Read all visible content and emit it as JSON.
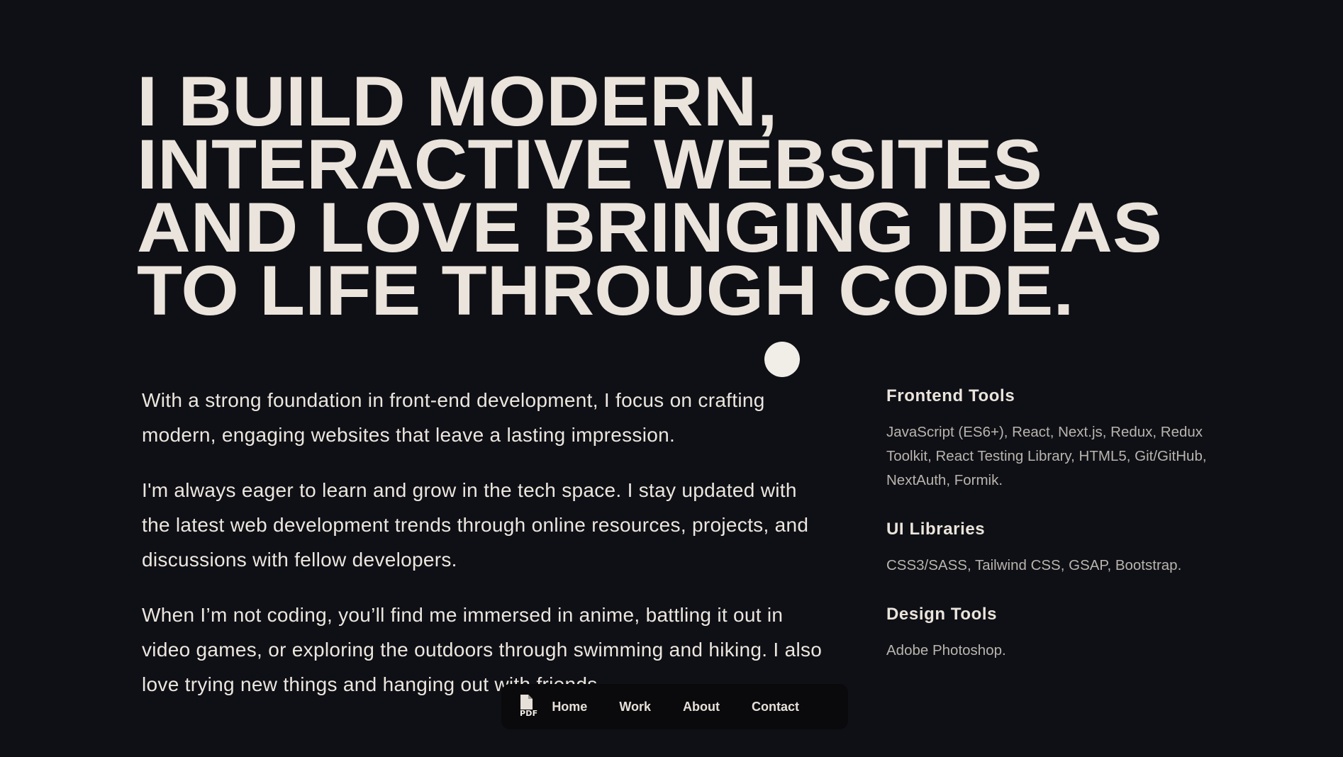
{
  "hero": {
    "lines": [
      "I build modern,",
      "interactive websites",
      "and love bringing ideas",
      "to life through code."
    ]
  },
  "about": {
    "paragraphs": [
      "With a strong foundation in front-end development, I focus on crafting modern, engaging websites that leave a lasting impression.",
      "I'm always eager to learn and grow in the tech space. I stay updated with the latest web development trends through online resources, projects, and discussions with fellow developers.",
      "When I’m not coding, you’ll find me immersed in anime, battling it out in video games, or exploring the outdoors through swimming and hiking. I also love trying new things and hanging out with friends."
    ]
  },
  "skills": [
    {
      "title": "Frontend Tools",
      "items": "JavaScript (ES6+), React, Next.js, Redux, Redux Toolkit, React Testing Library, HTML5, Git/GitHub, NextAuth, Formik."
    },
    {
      "title": "UI Libraries",
      "items": "CSS3/SASS, Tailwind CSS, GSAP, Bootstrap."
    },
    {
      "title": "Design Tools",
      "items": "Adobe Photoshop."
    }
  ],
  "nav": {
    "resume_icon": "pdf-file-icon",
    "pdf_label": "PDF",
    "items": [
      "Home",
      "Work",
      "About",
      "Contact"
    ]
  }
}
